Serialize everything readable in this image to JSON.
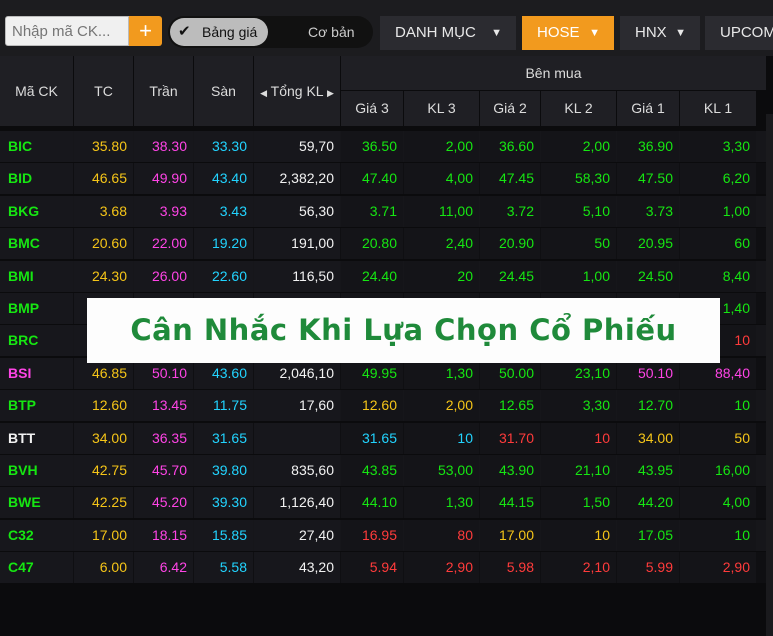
{
  "search": {
    "placeholder": "Nhập mã CK..."
  },
  "toolbar": {
    "add_label": "+",
    "toggle_on": "Bảng giá",
    "toggle_off": "Cơ bản",
    "tabs": [
      {
        "label": "DANH MỤC",
        "active": false
      },
      {
        "label": "HOSE",
        "active": true
      },
      {
        "label": "HNX",
        "active": false
      },
      {
        "label": "UPCOM",
        "active": false
      }
    ]
  },
  "header": {
    "symbol": "Mã CK",
    "ref": "TC",
    "ceil": "Trần",
    "floor": "Sàn",
    "volume": "Tổng KL",
    "group_buy": "Bên mua",
    "buy_cols": [
      "Giá 3",
      "KL 3",
      "Giá 2",
      "KL 2",
      "Giá 1",
      "KL 1"
    ]
  },
  "banner": {
    "text": "Cân Nhắc Khi Lựa Chọn Cổ Phiếu"
  },
  "colors": {
    "ceil": "#ff44e6",
    "floor": "#22d4ff",
    "ref": "#f5c518",
    "up": "#16e612",
    "down": "#ff3b3b",
    "white": "#f2f2f2"
  },
  "rows": [
    {
      "sym": "BIC",
      "symc": "up",
      "tc": "35.80",
      "tran": "38.30",
      "san": "33.30",
      "kl": "59,70",
      "b": [
        [
          "36.50",
          "up"
        ],
        [
          "2,00",
          "up"
        ],
        [
          "36.60",
          "up"
        ],
        [
          "2,00",
          "up"
        ],
        [
          "36.90",
          "up"
        ],
        [
          "3,30",
          "up"
        ]
      ]
    },
    {
      "sym": "BID",
      "symc": "up",
      "tc": "46.65",
      "tran": "49.90",
      "san": "43.40",
      "kl": "2,382,20",
      "b": [
        [
          "47.40",
          "up"
        ],
        [
          "4,00",
          "up"
        ],
        [
          "47.45",
          "up"
        ],
        [
          "58,30",
          "up"
        ],
        [
          "47.50",
          "up"
        ],
        [
          "6,20",
          "up"
        ]
      ]
    },
    {
      "sym": "BKG",
      "symc": "up",
      "tc": "3.68",
      "tran": "3.93",
      "san": "3.43",
      "kl": "56,30",
      "b": [
        [
          "3.71",
          "up"
        ],
        [
          "11,00",
          "up"
        ],
        [
          "3.72",
          "up"
        ],
        [
          "5,10",
          "up"
        ],
        [
          "3.73",
          "up"
        ],
        [
          "1,00",
          "up"
        ]
      ]
    },
    {
      "sym": "BMC",
      "symc": "up",
      "tc": "20.60",
      "tran": "22.00",
      "san": "19.20",
      "kl": "191,00",
      "b": [
        [
          "20.80",
          "up"
        ],
        [
          "2,40",
          "up"
        ],
        [
          "20.90",
          "up"
        ],
        [
          "50",
          "up"
        ],
        [
          "20.95",
          "up"
        ],
        [
          "60",
          "up"
        ]
      ]
    },
    {
      "sym": "BMI",
      "symc": "up",
      "tc": "24.30",
      "tran": "26.00",
      "san": "22.60",
      "kl": "116,50",
      "b": [
        [
          "24.40",
          "up"
        ],
        [
          "20",
          "up"
        ],
        [
          "24.45",
          "up"
        ],
        [
          "1,00",
          "up"
        ],
        [
          "24.50",
          "up"
        ],
        [
          "8,40",
          "up"
        ]
      ]
    },
    {
      "sym": "BMP",
      "symc": "up",
      "tc": "",
      "tran": "",
      "san": "",
      "kl": "",
      "b": [
        [
          "",
          "up"
        ],
        [
          "",
          "up"
        ],
        [
          "",
          "up"
        ],
        [
          "",
          "up"
        ],
        [
          "",
          "up"
        ],
        [
          "1,40",
          "up"
        ]
      ]
    },
    {
      "sym": "BRC",
      "symc": "up",
      "tc": "",
      "tran": "",
      "san": "",
      "kl": "",
      "b": [
        [
          "",
          "up"
        ],
        [
          "",
          "up"
        ],
        [
          "",
          "up"
        ],
        [
          "",
          "up"
        ],
        [
          "",
          "up"
        ],
        [
          "10",
          "down"
        ]
      ]
    },
    {
      "sym": "BSI",
      "symc": "ceil",
      "tc": "46.85",
      "tran": "50.10",
      "san": "43.60",
      "kl": "2,046,10",
      "b": [
        [
          "49.95",
          "up"
        ],
        [
          "1,30",
          "up"
        ],
        [
          "50.00",
          "up"
        ],
        [
          "23,10",
          "up"
        ],
        [
          "50.10",
          "ceil"
        ],
        [
          "88,40",
          "ceil"
        ]
      ]
    },
    {
      "sym": "BTP",
      "symc": "up",
      "tc": "12.60",
      "tran": "13.45",
      "san": "11.75",
      "kl": "17,60",
      "b": [
        [
          "12.60",
          "ref"
        ],
        [
          "2,00",
          "ref"
        ],
        [
          "12.65",
          "up"
        ],
        [
          "3,30",
          "up"
        ],
        [
          "12.70",
          "up"
        ],
        [
          "10",
          "up"
        ]
      ]
    },
    {
      "sym": "BTT",
      "symc": "white",
      "tc": "34.00",
      "tran": "36.35",
      "san": "31.65",
      "kl": "",
      "b": [
        [
          "31.65",
          "floor"
        ],
        [
          "10",
          "floor"
        ],
        [
          "31.70",
          "down"
        ],
        [
          "10",
          "down"
        ],
        [
          "34.00",
          "ref"
        ],
        [
          "50",
          "ref"
        ]
      ]
    },
    {
      "sym": "BVH",
      "symc": "up",
      "tc": "42.75",
      "tran": "45.70",
      "san": "39.80",
      "kl": "835,60",
      "b": [
        [
          "43.85",
          "up"
        ],
        [
          "53,00",
          "up"
        ],
        [
          "43.90",
          "up"
        ],
        [
          "21,10",
          "up"
        ],
        [
          "43.95",
          "up"
        ],
        [
          "16,00",
          "up"
        ]
      ]
    },
    {
      "sym": "BWE",
      "symc": "up",
      "tc": "42.25",
      "tran": "45.20",
      "san": "39.30",
      "kl": "1,126,40",
      "b": [
        [
          "44.10",
          "up"
        ],
        [
          "1,30",
          "up"
        ],
        [
          "44.15",
          "up"
        ],
        [
          "1,50",
          "up"
        ],
        [
          "44.20",
          "up"
        ],
        [
          "4,00",
          "up"
        ]
      ]
    },
    {
      "sym": "C32",
      "symc": "up",
      "tc": "17.00",
      "tran": "18.15",
      "san": "15.85",
      "kl": "27,40",
      "b": [
        [
          "16.95",
          "down"
        ],
        [
          "80",
          "down"
        ],
        [
          "17.00",
          "ref"
        ],
        [
          "10",
          "ref"
        ],
        [
          "17.05",
          "up"
        ],
        [
          "10",
          "up"
        ]
      ]
    },
    {
      "sym": "C47",
      "symc": "up",
      "tc": "6.00",
      "tran": "6.42",
      "san": "5.58",
      "kl": "43,20",
      "b": [
        [
          "5.94",
          "down"
        ],
        [
          "2,90",
          "down"
        ],
        [
          "5.98",
          "down"
        ],
        [
          "2,10",
          "down"
        ],
        [
          "5.99",
          "down"
        ],
        [
          "2,90",
          "down"
        ]
      ]
    }
  ]
}
